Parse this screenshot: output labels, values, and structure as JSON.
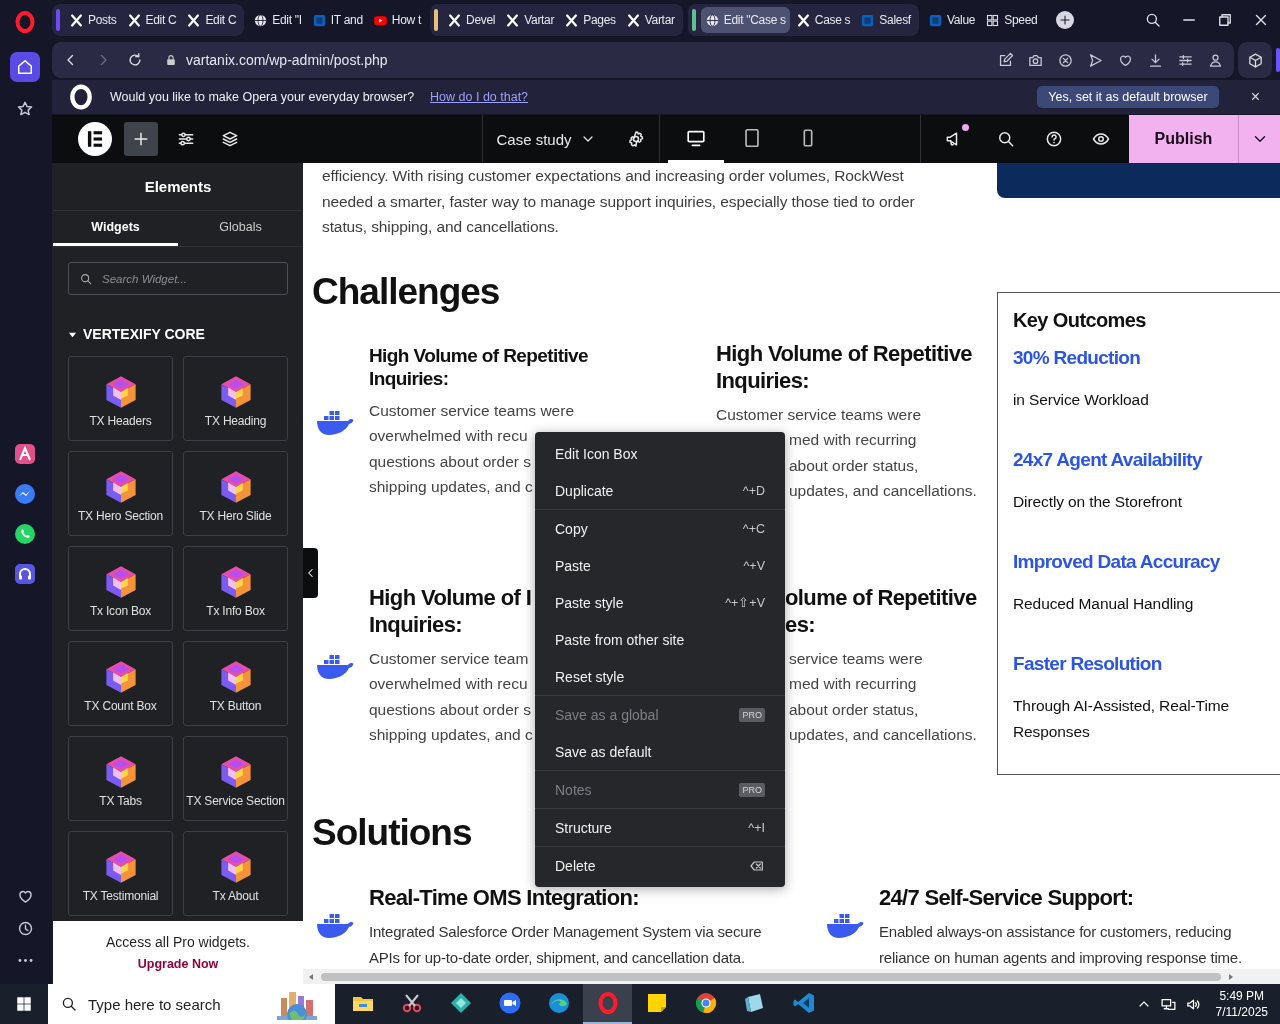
{
  "opera_sidebar": {
    "pinned": [
      {
        "kind": "home",
        "selected": true
      },
      {
        "kind": "star",
        "selected": false
      }
    ],
    "apps": [
      {
        "kind": "aria"
      },
      {
        "kind": "messenger"
      },
      {
        "kind": "whatsapp"
      },
      {
        "kind": "music"
      }
    ],
    "bottom": [
      {
        "kind": "heart"
      },
      {
        "kind": "clock"
      },
      {
        "kind": "more"
      }
    ]
  },
  "browser": {
    "tab_groups": [
      {
        "color": "#6b4cf6",
        "tabs": [
          {
            "title": "Posts",
            "kind": "x",
            "selected": false
          },
          {
            "title": "Edit C",
            "kind": "x",
            "selected": false
          },
          {
            "title": "Edit C",
            "kind": "x",
            "selected": false
          }
        ]
      },
      {
        "tabs": [
          {
            "title": "Edit \"I",
            "kind": "globe",
            "selected": false
          },
          {
            "title": "IT and",
            "kind": "square",
            "selected": false
          },
          {
            "title": "How t",
            "kind": "video",
            "selected": false
          }
        ]
      },
      {
        "color": "#e8c07c",
        "tabs": [
          {
            "title": "Devel",
            "kind": "x",
            "selected": false
          },
          {
            "title": "Vartar",
            "kind": "x",
            "selected": false
          },
          {
            "title": "Pages",
            "kind": "x",
            "selected": false
          },
          {
            "title": "Vartar",
            "kind": "x",
            "selected": false
          }
        ]
      },
      {
        "color": "#5ec08e",
        "tabs": [
          {
            "title": "Edit \"Case s",
            "kind": "globe",
            "selected": true
          },
          {
            "title": "Case s",
            "kind": "x",
            "selected": false
          },
          {
            "title": "Salesf",
            "kind": "square",
            "selected": false
          }
        ]
      },
      {
        "tabs": [
          {
            "title": "Value",
            "kind": "square",
            "selected": false
          },
          {
            "title": "Speed",
            "kind": "grid",
            "selected": false
          }
        ]
      }
    ],
    "address": "vartanix.com/wp-admin/post.php",
    "banner": {
      "message": "Would you like to make Opera your everyday browser?",
      "link": "How do I do that?",
      "button": "Yes, set it as default browser",
      "close": "×"
    }
  },
  "editor": {
    "add_selected": true,
    "document": "Case study",
    "devices": [
      {
        "kind": "desktop",
        "selected": true
      },
      {
        "kind": "tablet",
        "selected": false
      },
      {
        "kind": "mobile",
        "selected": false
      }
    ],
    "notification": true,
    "publish": "Publish"
  },
  "panel": {
    "title": "Elements",
    "tabs": [
      {
        "label": "Widgets",
        "selected": true
      },
      {
        "label": "Globals",
        "selected": false
      }
    ],
    "search": {
      "placeholder": "Search Widget..."
    },
    "category": {
      "label": "VERTEXIFY CORE",
      "expanded": true
    },
    "widgets": [
      "TX Headers",
      "TX Heading",
      "TX Hero Section",
      "TX Hero Slide",
      "Tx Icon Box",
      "Tx Info Box",
      "TX Count Box",
      "TX Button",
      "TX Tabs",
      "TX Service Section",
      "TX Testimonial",
      "Tx About"
    ],
    "promo": {
      "text": "Access all Pro widgets.",
      "link": "Upgrade Now"
    }
  },
  "canvas": {
    "intro_lines": [
      "efficiency. With rising customer expectations and increasing order volumes, RockWest",
      "needed a smarter, faster way to manage support inquiries, especially those tied to order",
      "status, shipping, and cancellations."
    ],
    "challenges": {
      "title": "Challenges",
      "cards": [
        {
          "heading": [
            {
              "text": "High Volume of Repetitive"
            },
            {
              "text": "Inquiries:"
            }
          ],
          "body": [
            {
              "text": "Customer service teams were"
            },
            {
              "text": "overwhelmed with recu"
            },
            {
              "text": "questions about order s"
            },
            {
              "text": "shipping updates, and c"
            }
          ]
        },
        {
          "heading": [
            {
              "text": "High Volume of Repetitive"
            },
            {
              "text": "Inquiries:"
            }
          ],
          "body": [
            {
              "text": "Customer service teams were"
            },
            {
              "text": "med with recurring",
              "cut_left": true
            },
            {
              "text": "about order status,",
              "cut_left": true
            },
            {
              "text": "updates, and cancellations.",
              "cut_left": true
            }
          ]
        },
        {
          "heading": [
            {
              "text": "High Volume of I"
            },
            {
              "text": "Inquiries:"
            }
          ],
          "body": [
            {
              "text": "Customer service team"
            },
            {
              "text": "overwhelmed with recu"
            },
            {
              "text": "questions about order s"
            },
            {
              "text": "shipping updates, and c"
            }
          ]
        },
        {
          "heading": [
            {
              "text": "olume of Repetitive",
              "cut_left": true
            },
            {
              "text": "es:",
              "cut_left": true
            }
          ],
          "body": [
            {
              "text": "service teams were",
              "cut_left": true
            },
            {
              "text": "med with recurring",
              "cut_left": true
            },
            {
              "text": "about order status,",
              "cut_left": true
            },
            {
              "text": "updates, and cancellations.",
              "cut_left": true
            }
          ]
        }
      ]
    },
    "outcomes": {
      "title": "Key Outcomes",
      "items": [
        {
          "value": "30% Reduction",
          "detail": "in Service Workload"
        },
        {
          "value": "24x7 Agent Availability",
          "detail": "Directly on the Storefront"
        },
        {
          "value": "Improved Data Accuracy",
          "detail": "Reduced Manual Handling"
        },
        {
          "value": "Faster Resolution",
          "detail": "Through AI-Assisted, Real-Time Responses"
        }
      ]
    },
    "solutions": {
      "title": "Solutions",
      "cards": [
        {
          "heading": "Real-Time OMS Integration:",
          "body_lines": [
            "Integrated Salesforce Order Management System via secure",
            "APIs for up-to-date order, shipment, and cancellation data."
          ]
        },
        {
          "heading": "24/7 Self-Service Support:",
          "body_lines": [
            "Enabled always-on assistance for customers, reducing",
            "reliance on human agents and improving response time."
          ]
        }
      ]
    }
  },
  "context_menu": {
    "groups": [
      [
        {
          "label": "Edit Icon Box",
          "kind": "action",
          "disabled": false
        },
        {
          "label": "Duplicate",
          "shortcut": "^+D",
          "kind": "action",
          "disabled": false
        }
      ],
      [
        {
          "label": "Copy",
          "shortcut": "^+C",
          "kind": "action",
          "disabled": false
        },
        {
          "label": "Paste",
          "shortcut": "^+V",
          "kind": "action",
          "disabled": false
        },
        {
          "label": "Paste style",
          "shortcut": "^+⇧+V",
          "kind": "action",
          "disabled": false
        },
        {
          "label": "Paste from other site",
          "kind": "action",
          "disabled": false
        },
        {
          "label": "Reset style",
          "kind": "action",
          "disabled": false
        }
      ],
      [
        {
          "label": "Save as a global",
          "badge": "PRO",
          "kind": "action",
          "disabled": true
        },
        {
          "label": "Save as default",
          "kind": "action",
          "disabled": false
        }
      ],
      [
        {
          "label": "Notes",
          "badge": "PRO",
          "kind": "action",
          "disabled": true
        }
      ],
      [
        {
          "label": "Structure",
          "shortcut": "^+I",
          "kind": "action",
          "disabled": false
        }
      ],
      [
        {
          "label": "Delete",
          "kind": "delete",
          "disabled": false
        }
      ]
    ]
  },
  "taskbar": {
    "search_placeholder": "Type here to search",
    "apps": [
      {
        "kind": "folder",
        "selected": false
      },
      {
        "kind": "scissors",
        "selected": false
      },
      {
        "kind": "diamond",
        "selected": false
      },
      {
        "kind": "camera",
        "selected": false
      },
      {
        "kind": "edge",
        "selected": false
      },
      {
        "kind": "opera",
        "selected": true
      },
      {
        "kind": "note",
        "selected": false
      },
      {
        "kind": "chrome",
        "selected": false
      },
      {
        "kind": "tile",
        "selected": false
      },
      {
        "kind": "code",
        "selected": false
      }
    ],
    "time": "5:49 PM",
    "date": "7/11/2025"
  }
}
